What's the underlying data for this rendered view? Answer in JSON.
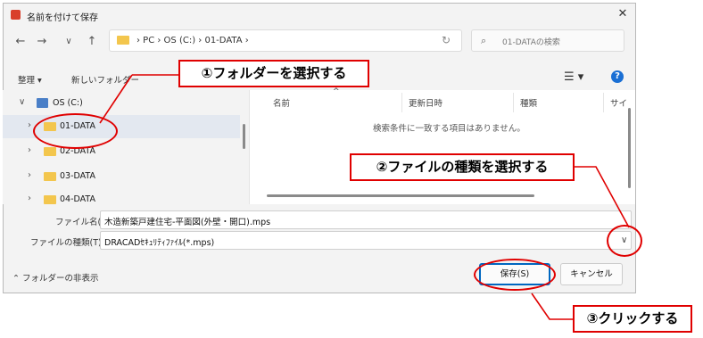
{
  "dialog": {
    "title": "名前を付けて保存",
    "close_glyph": "✕"
  },
  "nav": {
    "back_glyph": "←",
    "forward_glyph": "→",
    "recent_glyph": "∨",
    "up_glyph": "↑",
    "address": "›  PC  ›  OS (C:)  ›  01-DATA  ›",
    "refresh_glyph": "↻",
    "search_placeholder": "01-DATAの検索"
  },
  "toolbar": {
    "organize": "整理 ▾",
    "new_folder": "新しいフォルダー",
    "view_glyph": "☰ ▾",
    "help_glyph": "?"
  },
  "tree": {
    "items": [
      {
        "label": "OS (C:)",
        "chevron": "∨"
      },
      {
        "label": "01-DATA",
        "chevron": "›"
      },
      {
        "label": "02-DATA",
        "chevron": "›"
      },
      {
        "label": "03-DATA",
        "chevron": "›"
      },
      {
        "label": "04-DATA",
        "chevron": "›"
      }
    ]
  },
  "columns": {
    "name": "名前",
    "sort_glyph": "^",
    "date": "更新日時",
    "type": "種類",
    "size": "サイ"
  },
  "content": {
    "empty_message": "検索条件に一致する項目はありません。"
  },
  "fields": {
    "filename_label": "ファイル名(N):",
    "filename_value": "木造新築戸建住宅-平面図(外壁・開口).mps",
    "filetype_label": "ファイルの種類(T):",
    "filetype_value": "DRACADｾｷｭﾘﾃｨﾌｧｲﾙ(*.mps)",
    "combo_glyph": "∨"
  },
  "footer": {
    "hide_folders": "⌃  フォルダーの非表示",
    "save": "保存(S)",
    "cancel": "キャンセル"
  },
  "annotations": {
    "step1": "①フォルダーを選択する",
    "step2": "②ファイルの種類を選択する",
    "step3": "③クリックする",
    "color": "#e00000"
  },
  "colors": {
    "accent": "#0067c0",
    "folder": "#f3c64d",
    "selection": "#e3e8f0"
  }
}
